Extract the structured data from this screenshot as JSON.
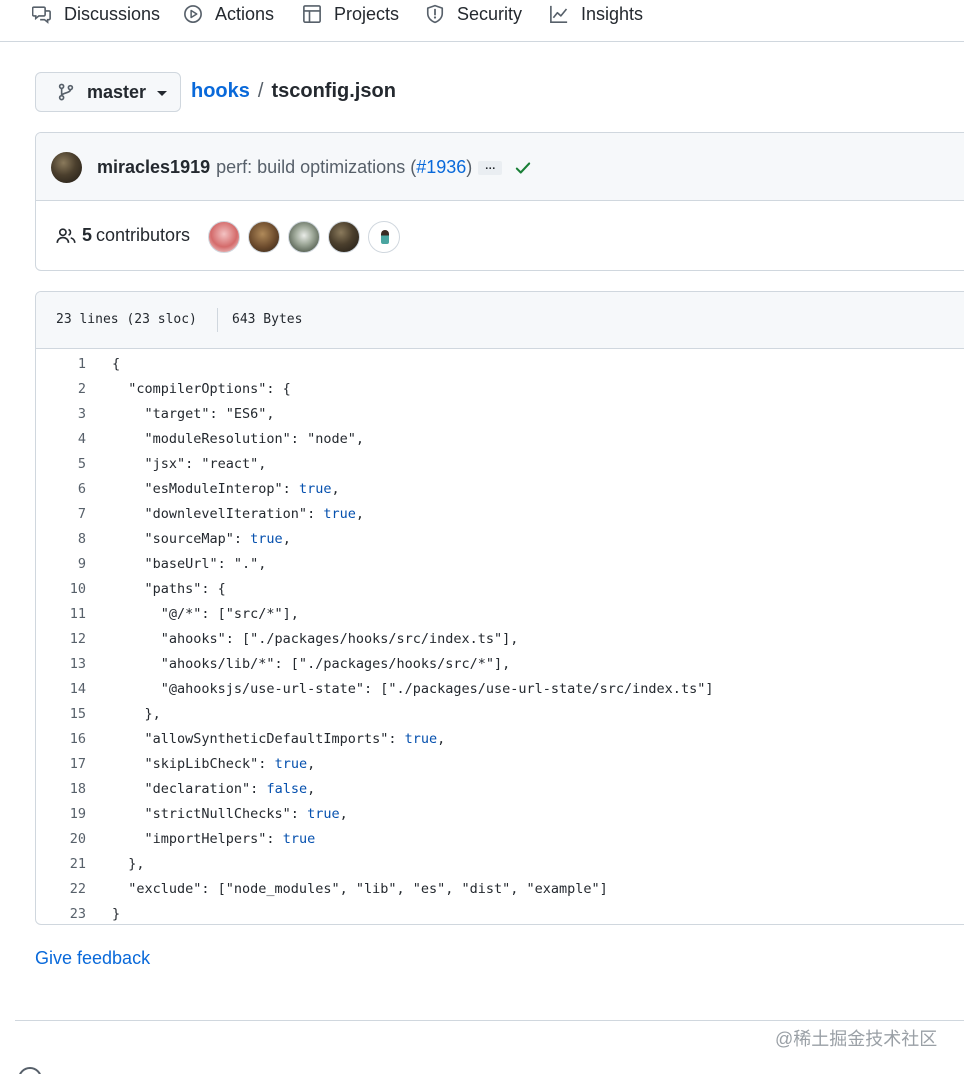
{
  "nav": {
    "items": [
      {
        "label": "Discussions",
        "icon": "comment-discussion-icon"
      },
      {
        "label": "Actions",
        "icon": "play-icon"
      },
      {
        "label": "Projects",
        "icon": "table-icon"
      },
      {
        "label": "Security",
        "icon": "shield-icon"
      },
      {
        "label": "Insights",
        "icon": "graph-icon"
      }
    ]
  },
  "branch": {
    "name": "master"
  },
  "breadcrumb": {
    "repo": "hooks",
    "separator": "/",
    "file": "tsconfig.json"
  },
  "commit": {
    "author": "miracles1919",
    "message": "perf: build optimizations (",
    "pr": "#1936",
    "message_end": ")",
    "ellipsis": "…",
    "status": "success"
  },
  "contributors": {
    "count": "5",
    "label": "contributors"
  },
  "file": {
    "lines_info": "23 lines (23 sloc)",
    "size": "643 Bytes",
    "code": [
      {
        "n": "1",
        "text": "{"
      },
      {
        "n": "2",
        "text": "  \"compilerOptions\": {"
      },
      {
        "n": "3",
        "text": "    \"target\": \"ES6\","
      },
      {
        "n": "4",
        "text": "    \"moduleResolution\": \"node\","
      },
      {
        "n": "5",
        "text": "    \"jsx\": \"react\","
      },
      {
        "n": "6",
        "text": "    \"esModuleInterop\": ",
        "kw": "true",
        "tail": ","
      },
      {
        "n": "7",
        "text": "    \"downlevelIteration\": ",
        "kw": "true",
        "tail": ","
      },
      {
        "n": "8",
        "text": "    \"sourceMap\": ",
        "kw": "true",
        "tail": ","
      },
      {
        "n": "9",
        "text": "    \"baseUrl\": \".\","
      },
      {
        "n": "10",
        "text": "    \"paths\": {"
      },
      {
        "n": "11",
        "text": "      \"@/*\": [\"src/*\"],"
      },
      {
        "n": "12",
        "text": "      \"ahooks\": [\"./packages/hooks/src/index.ts\"],"
      },
      {
        "n": "13",
        "text": "      \"ahooks/lib/*\": [\"./packages/hooks/src/*\"],"
      },
      {
        "n": "14",
        "text": "      \"@ahooksjs/use-url-state\": [\"./packages/use-url-state/src/index.ts\"]"
      },
      {
        "n": "15",
        "text": "    },"
      },
      {
        "n": "16",
        "text": "    \"allowSyntheticDefaultImports\": ",
        "kw": "true",
        "tail": ","
      },
      {
        "n": "17",
        "text": "    \"skipLibCheck\": ",
        "kw": "true",
        "tail": ","
      },
      {
        "n": "18",
        "text": "    \"declaration\": ",
        "kw": "false",
        "tail": ","
      },
      {
        "n": "19",
        "text": "    \"strictNullChecks\": ",
        "kw": "true",
        "tail": ","
      },
      {
        "n": "20",
        "text": "    \"importHelpers\": ",
        "kw": "true",
        "tail": ""
      },
      {
        "n": "21",
        "text": "  },"
      },
      {
        "n": "22",
        "text": "  \"exclude\": [\"node_modules\", \"lib\", \"es\", \"dist\", \"example\"]"
      },
      {
        "n": "23",
        "text": "}"
      }
    ]
  },
  "feedback": {
    "label": "Give feedback"
  },
  "watermark": {
    "text": "@稀土掘金技术社区"
  },
  "colors": {
    "link": "#0969da",
    "success": "#1a7f37",
    "keyword": "#0550ae",
    "border": "#d0d7de"
  }
}
